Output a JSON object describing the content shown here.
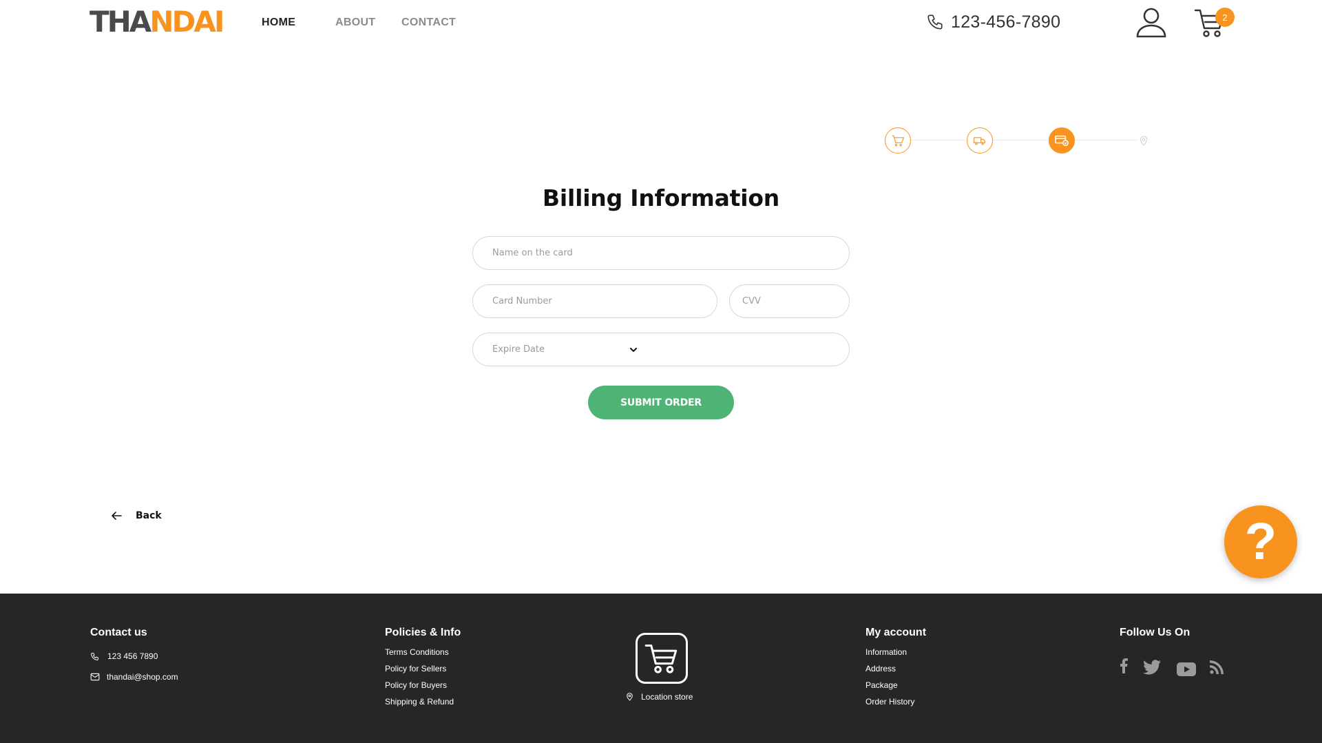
{
  "header": {
    "logo_part1": "THA",
    "logo_part2": "NDAI",
    "nav": {
      "home": "HOME",
      "about": "ABOUT",
      "contact": "CONTACT"
    },
    "phone": "123-456-7890",
    "cart_count": "2"
  },
  "stepper": {
    "steps": [
      {
        "icon": "cart-icon",
        "state": "done"
      },
      {
        "icon": "truck-icon",
        "state": "done"
      },
      {
        "icon": "payment-card-icon",
        "state": "active"
      },
      {
        "icon": "location-pin-icon",
        "state": "pending"
      }
    ]
  },
  "form": {
    "title": "Billing Information",
    "name_placeholder": "Name on the card",
    "card_placeholder": "Card Number",
    "cvv_placeholder": "CVV",
    "expire_label": "Expire Date",
    "submit_label": "SUBMIT ORDER"
  },
  "back_label": "Back",
  "help_label": "?",
  "footer": {
    "contact": {
      "title": "Contact us",
      "phone": "123 456 7890",
      "email": "thandai@shop.com"
    },
    "policies": {
      "title": "Policies & Info",
      "links": [
        "Terms Conditions",
        "Policy for Sellers",
        "Policy for Buyers",
        "Shipping & Refund"
      ]
    },
    "store": {
      "label": "Location store"
    },
    "account": {
      "title": "My account",
      "links": [
        "Information",
        "Address",
        "Package",
        "Order History"
      ]
    },
    "follow": {
      "title": "Follow Us On",
      "icons": [
        "facebook-icon",
        "twitter-icon",
        "youtube-icon",
        "rss-icon"
      ]
    }
  },
  "colors": {
    "accent": "#f7931e",
    "submit": "#4db476",
    "footer_bg": "#262626"
  }
}
